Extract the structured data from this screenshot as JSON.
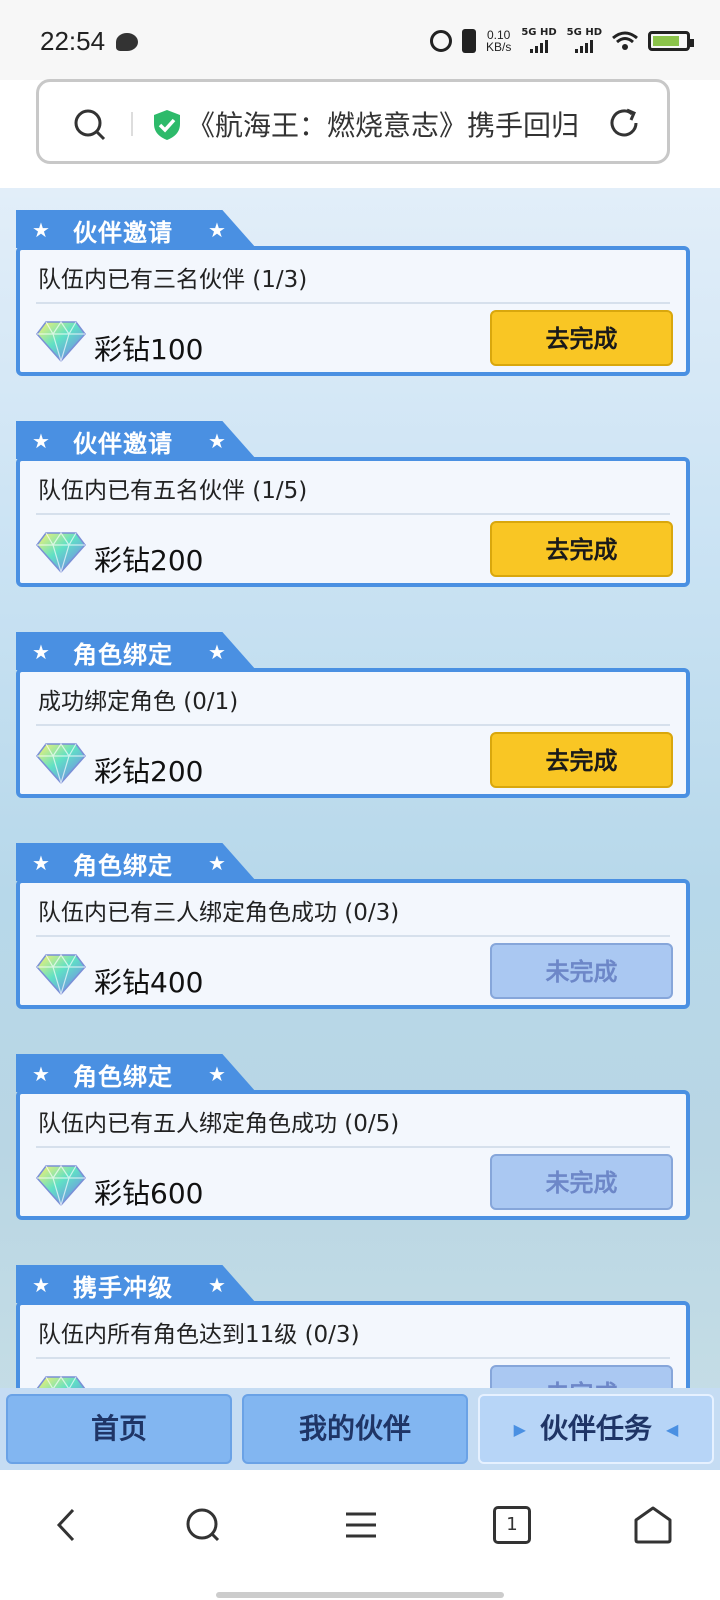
{
  "status": {
    "time": "22:54",
    "net_speed_value": "0.10",
    "net_speed_unit": "KB/s",
    "sim1": "5G HD",
    "sim2": "5G HD",
    "battery_level": 0.8,
    "icons": [
      "chat-bubble-icon",
      "alarm-icon",
      "vibrate-icon",
      "signal-icon",
      "wifi-icon",
      "battery-icon"
    ]
  },
  "browser": {
    "page_title": "《航海王：燃烧意志》携手回归"
  },
  "tasks": [
    {
      "category": "伙伴邀请",
      "desc": "队伍内已有三名伙伴 (1/3)",
      "reward": "彩钻100",
      "button": "去完成",
      "state": "go"
    },
    {
      "category": "伙伴邀请",
      "desc": "队伍内已有五名伙伴 (1/5)",
      "reward": "彩钻200",
      "button": "去完成",
      "state": "go"
    },
    {
      "category": "角色绑定",
      "desc": "成功绑定角色 (0/1)",
      "reward": "彩钻200",
      "button": "去完成",
      "state": "go"
    },
    {
      "category": "角色绑定",
      "desc": "队伍内已有三人绑定角色成功 (0/3)",
      "reward": "彩钻400",
      "button": "未完成",
      "state": "pending"
    },
    {
      "category": "角色绑定",
      "desc": "队伍内已有五人绑定角色成功 (0/5)",
      "reward": "彩钻600",
      "button": "未完成",
      "state": "pending"
    },
    {
      "category": "携手冲级",
      "desc": "队伍内所有角色达到11级 (0/3)",
      "reward": "",
      "button": "未完成",
      "state": "pending"
    }
  ],
  "bottom_tabs": [
    {
      "label": "首页"
    },
    {
      "label": "我的伙伴"
    },
    {
      "label": "伙伴任务",
      "active": true
    }
  ],
  "colors": {
    "accent": "#4a90e2",
    "go_button": "#f9c624",
    "pending_button": "#aac8f2"
  },
  "nav": {
    "page_count": "1"
  }
}
